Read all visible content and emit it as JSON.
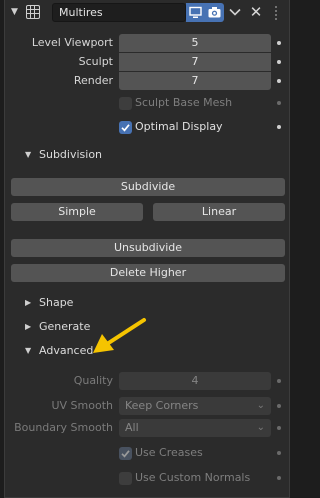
{
  "header": {
    "modifier_name": "Multires",
    "toggles": [
      "viewport-display-icon",
      "render-camera-icon"
    ],
    "close_symbol": "✕"
  },
  "levels": {
    "viewport_label": "Level Viewport",
    "viewport_value": "5",
    "sculpt_label": "Sculpt",
    "sculpt_value": "7",
    "render_label": "Render",
    "render_value": "7"
  },
  "options": {
    "sculpt_base_mesh": {
      "label": "Sculpt Base Mesh",
      "checked": false,
      "enabled": false
    },
    "optimal_display": {
      "label": "Optimal Display",
      "checked": true,
      "enabled": true
    }
  },
  "subdivision": {
    "title": "Subdivision",
    "expanded": true,
    "subdivide_label": "Subdivide",
    "simple_label": "Simple",
    "linear_label": "Linear",
    "unsubdivide_label": "Unsubdivide",
    "delete_higher_label": "Delete Higher"
  },
  "shape": {
    "title": "Shape",
    "expanded": false
  },
  "generate": {
    "title": "Generate",
    "expanded": false
  },
  "advanced": {
    "title": "Advanced",
    "expanded": true,
    "quality_label": "Quality",
    "quality_value": "4",
    "uv_smooth_label": "UV Smooth",
    "uv_smooth_value": "Keep Corners",
    "boundary_smooth_label": "Boundary Smooth",
    "boundary_smooth_value": "All",
    "use_creases": {
      "label": "Use Creases",
      "checked": true,
      "enabled": false
    },
    "use_custom_normals": {
      "label": "Use Custom Normals",
      "checked": false,
      "enabled": false
    }
  },
  "colors": {
    "accent": "#4772b3",
    "panel_bg": "#2b2b2b",
    "button_bg": "#545454",
    "annotation_arrow": "#f5c400"
  }
}
